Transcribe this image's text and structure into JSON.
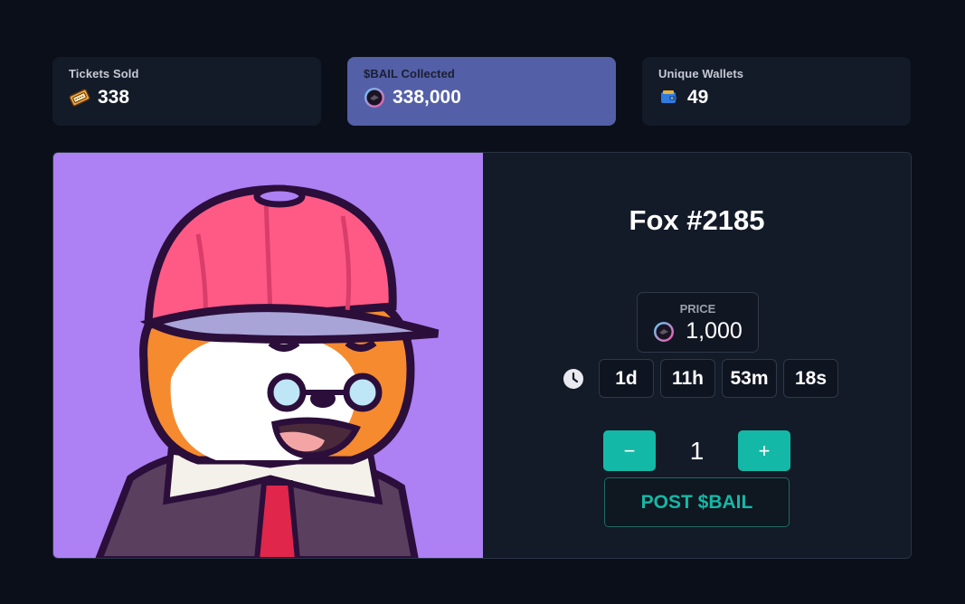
{
  "stats": [
    {
      "label": "Tickets Sold",
      "value": "338",
      "icon": "ticket-icon"
    },
    {
      "label": "$BAIL Collected",
      "value": "338,000",
      "icon": "bail-token-icon"
    },
    {
      "label": "Unique Wallets",
      "value": "49",
      "icon": "wallet-icon"
    }
  ],
  "nft": {
    "title": "Fox #2185",
    "price_label": "PRICE",
    "price_value": "1,000",
    "price_icon": "bail-token-icon"
  },
  "timer": {
    "icon": "clock-icon",
    "days": "1d",
    "hours": "11h",
    "minutes": "53m",
    "seconds": "18s"
  },
  "quantity": {
    "decrement": "−",
    "value": "1",
    "increment": "+"
  },
  "post_button": "POST $BAIL",
  "colors": {
    "background": "#0b0f19",
    "card": "#131a28",
    "active_card": "#535fa6",
    "art_background": "#ad80f3",
    "accent": "#14b8a6"
  }
}
